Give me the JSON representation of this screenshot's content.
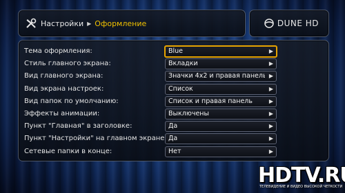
{
  "header": {
    "breadcrumb_root": "Настройки",
    "breadcrumb_current": "Оформление",
    "tools_icon": "tools-icon"
  },
  "brand": {
    "logo_text": "DUNE HD"
  },
  "settings": [
    {
      "label": "Тема оформления:",
      "value": "Blue",
      "selected": true
    },
    {
      "label": "Стиль главного экрана:",
      "value": "Вкладки"
    },
    {
      "label": "Вид главного экрана:",
      "value": "Значки 4х2 и правая панель"
    },
    {
      "label": "Вид экрана настроек:",
      "value": "Список"
    },
    {
      "label": "Вид папок по умолчанию:",
      "value": "Список и правая панель"
    },
    {
      "label": "Эффекты анимации:",
      "value": "Выключены"
    },
    {
      "label": "Пункт \"Главная\" в заголовке:",
      "value": "Да"
    },
    {
      "label": "Пункт \"Настройки\" на главном экране:",
      "value": "Да"
    },
    {
      "label": "Сетевые папки в конце:",
      "value": "Нет"
    }
  ],
  "arrow_glyph": "▶",
  "watermark": {
    "title": "HDTV.RU",
    "subtitle": "ТЕЛЕВИДЕНИЕ И ВИДЕО ВЫСОКОЙ ЧЕТКОСТИ"
  },
  "colors": {
    "accent": "#f0c000",
    "selection_border": "#e8a400",
    "background": "#173a78"
  }
}
